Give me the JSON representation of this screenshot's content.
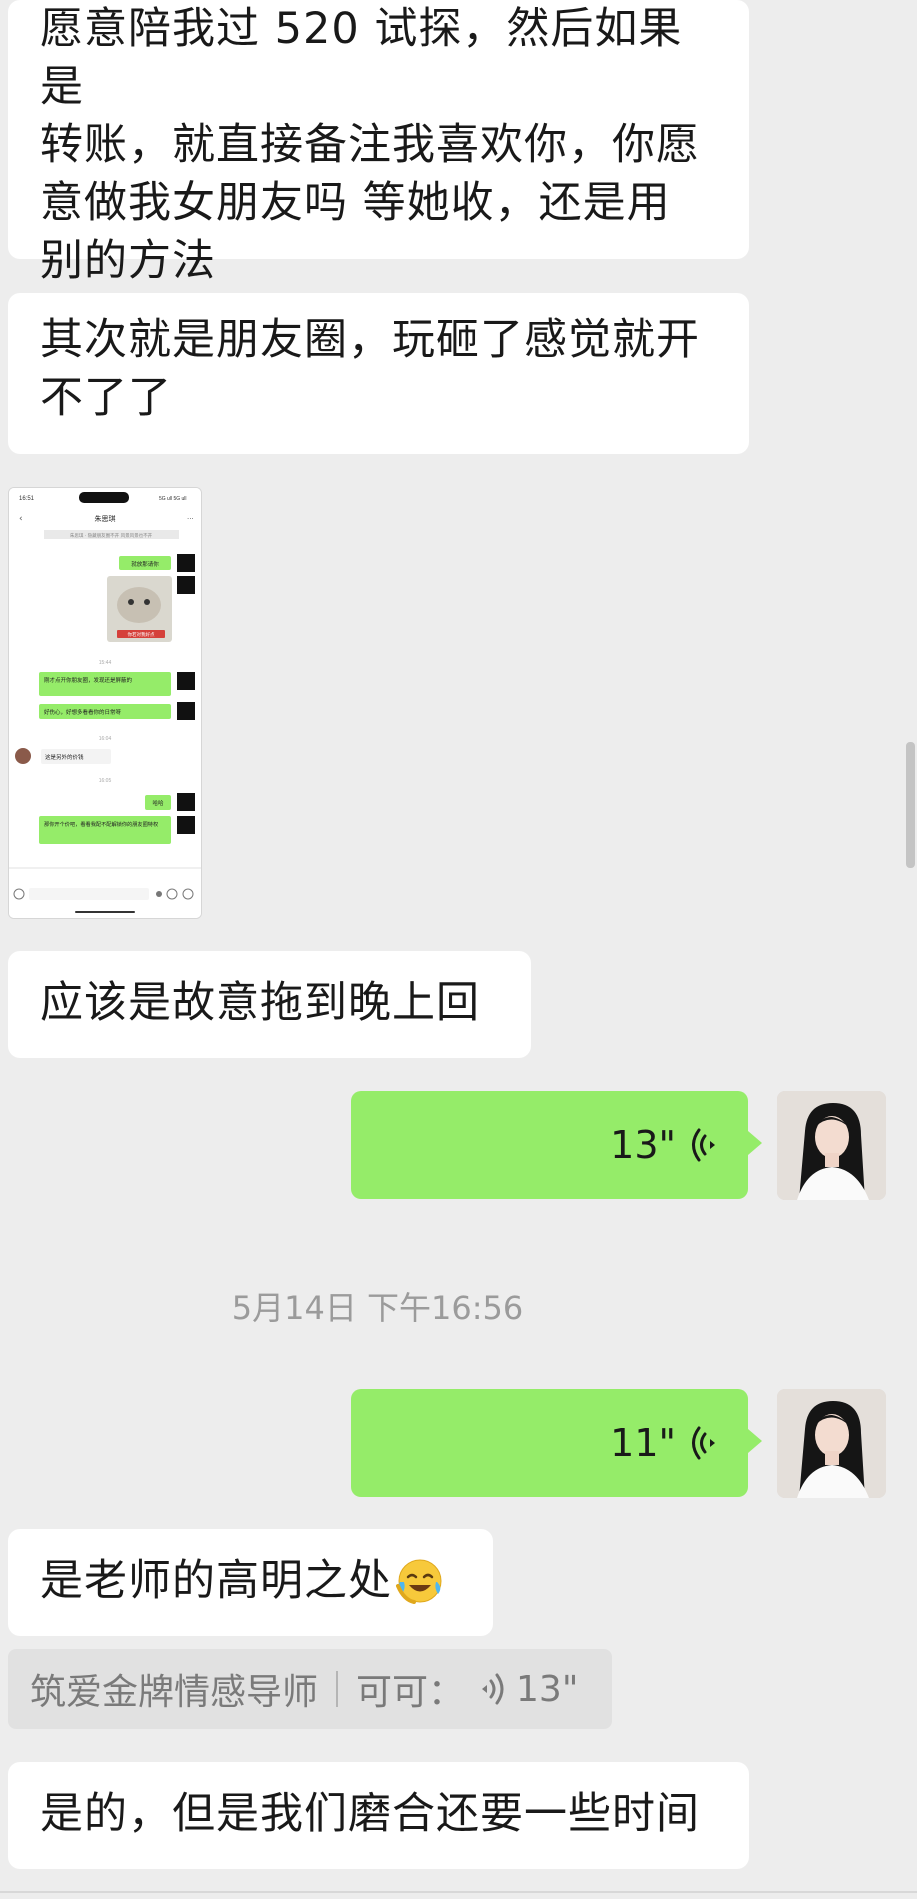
{
  "messages": {
    "m1": {
      "lines": [
        "愿意陪我过 520 试探，然后如果是",
        "转账，就直接备注我喜欢你，你愿",
        "意做我女朋友吗  等她收，还是用",
        "别的方法"
      ]
    },
    "m2": {
      "lines": [
        "其次就是朋友圈，玩砸了感觉就开",
        "不了了"
      ]
    },
    "m3": {
      "text": "应该是故意拖到晚上回"
    },
    "v1": {
      "duration": "13\""
    },
    "timestamp": "5月14日 下午16:56",
    "v2": {
      "duration": "11\""
    },
    "m4": {
      "text": "是老师的高明之处"
    },
    "quote": {
      "sender": "筑爱金牌情感导师",
      "name": "可可：",
      "duration": "13\""
    },
    "m5": {
      "text": "是的，但是我们磨合还要一些时间"
    }
  },
  "screenshot": {
    "status_time": "16:51",
    "status_right": "5G ull 5G ull",
    "contact": "朱思琪",
    "notice": "朱思琪 · 隐藏朋友圈不开 风景风景也不开",
    "msgs": [
      {
        "side": "out",
        "text": "就放那请你"
      },
      {
        "side": "out",
        "text": "你若对我好点"
      },
      {
        "time": "15:44"
      },
      {
        "side": "out",
        "text": "刚才点开你朋友圈，发现还是屏蔽的"
      },
      {
        "side": "out",
        "text": "好伤心，好想多看看你的日常呀"
      },
      {
        "time": "16:04"
      },
      {
        "side": "in",
        "text": "这是另外的价钱"
      },
      {
        "time": "16:05"
      },
      {
        "side": "out",
        "text": "哈哈"
      },
      {
        "side": "out",
        "text": "那你开个价吧，看看我配不配解锁你的朋友圈特权"
      }
    ]
  },
  "colors": {
    "background": "#ededed",
    "incoming": "#ffffff",
    "outgoing": "#95ec69",
    "timestamp": "#9b9b9b",
    "quote_bg": "#e1e1e1"
  },
  "icons": {
    "voice": "voice-waves-icon",
    "emoji": "cry-laugh-emoji-icon",
    "avatar": "user-avatar"
  }
}
